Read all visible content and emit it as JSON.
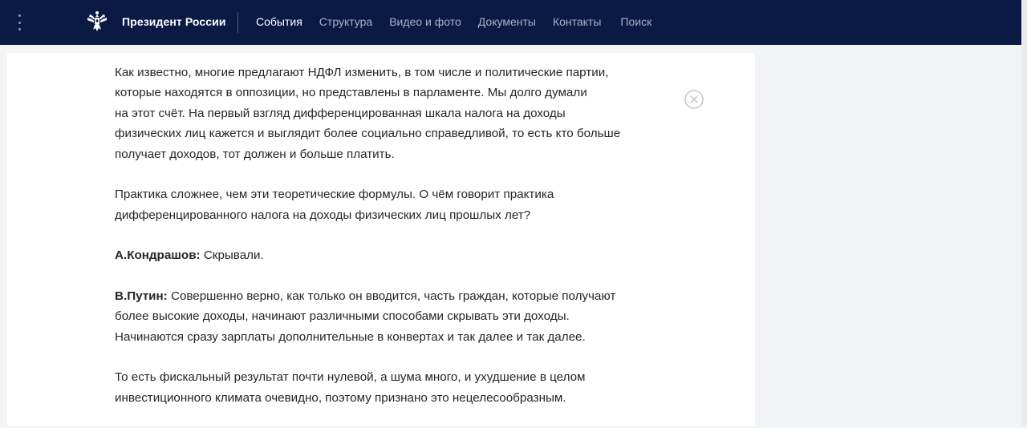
{
  "header": {
    "site_title": "Президент России",
    "nav": [
      {
        "label": "События",
        "active": true
      },
      {
        "label": "Структура",
        "active": false
      },
      {
        "label": "Видео и фото",
        "active": false
      },
      {
        "label": "Документы",
        "active": false
      },
      {
        "label": "Контакты",
        "active": false
      },
      {
        "label": "Поиск",
        "active": false
      }
    ],
    "menu_icon": "vertical-dots-icon",
    "logo_icon": "double-headed-eagle-icon",
    "colors": {
      "bar": "#0a1a45",
      "active_link": "#ffffff",
      "link": "#a9b1c6"
    }
  },
  "article": {
    "p1_lines": [
      "Как известно, многие предлагают НДФЛ изменить, в том числе и политические партии,",
      "которые находятся в оппозиции, но представлены в парламенте. Мы долго думали",
      "на этот счёт. На первый взгляд дифференцированная шкала налога на доходы",
      "физических лиц кажется и выглядит более социально справедливой, то есть кто больше",
      "получает доходов, тот должен и больше платить."
    ],
    "p2_lines": [
      "Практика сложнее, чем эти теоретические формулы. О чём говорит практика",
      "дифференцированного налога на доходы физических лиц прошлых лет?"
    ],
    "p3_speaker": "А.Кондрашов:",
    "p3_text": " Скрывали.",
    "p4_speaker": "В.Путин:",
    "p4_lines": [
      " Совершенно верно, как только он вводится, часть граждан, которые получают",
      "более высокие доходы, начинают различными способами скрывать эти доходы.",
      "Начинаются сразу зарплаты дополнительные в конвертах и так далее и так далее."
    ],
    "p5_lines": [
      "То есть фискальный результат почти нулевой, а шума много, и ухудшение в целом",
      "инвестиционного климата очевидно, поэтому признано это нецелесообразным."
    ]
  },
  "close_icon": "circle-x-icon"
}
